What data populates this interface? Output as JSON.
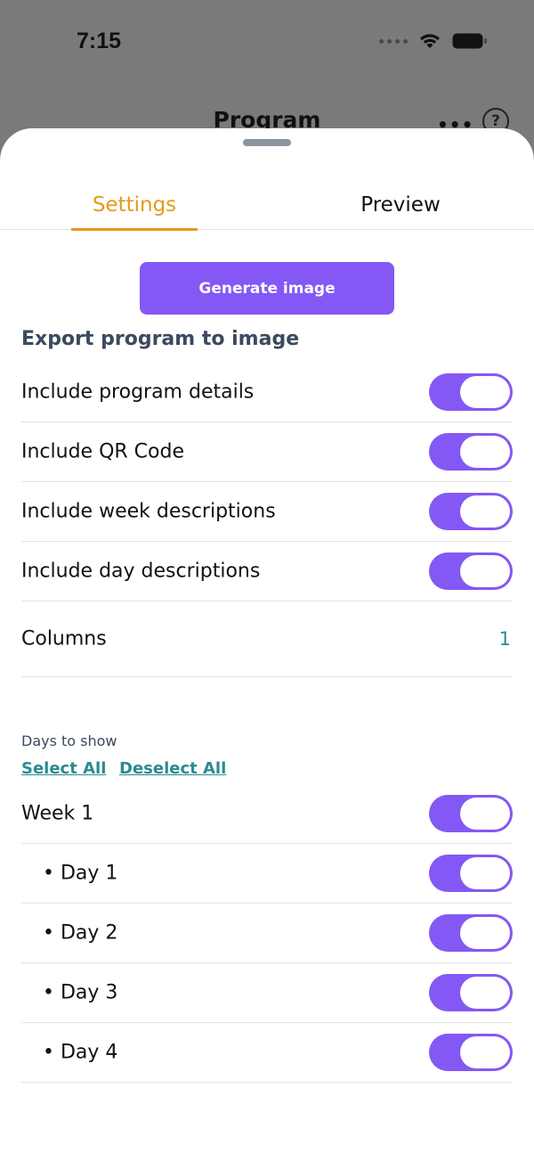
{
  "status_bar": {
    "time": "7:15",
    "icons": [
      "cellular-dots-icon",
      "wifi-icon",
      "battery-icon"
    ]
  },
  "background_nav": {
    "title": "Program",
    "more_icon": "more-horizontal-icon",
    "help_label": "?"
  },
  "tabs": [
    {
      "label": "Settings",
      "active": true
    },
    {
      "label": "Preview",
      "active": false
    }
  ],
  "generate_button": {
    "label": "Generate image"
  },
  "export_section": {
    "title": "Export program to image",
    "options": [
      {
        "label": "Include program details",
        "on": true
      },
      {
        "label": "Include QR Code",
        "on": true
      },
      {
        "label": "Include week descriptions",
        "on": true
      },
      {
        "label": "Include day descriptions",
        "on": true
      }
    ],
    "columns": {
      "label": "Columns",
      "value": "1"
    }
  },
  "days_section": {
    "caption": "Days to show",
    "select_all": "Select All",
    "deselect_all": "Deselect All",
    "items": [
      {
        "label": "Week 1",
        "on": true
      },
      {
        "label": "• Day 1",
        "on": true
      },
      {
        "label": "• Day 2",
        "on": true
      },
      {
        "label": "• Day 3",
        "on": true
      },
      {
        "label": "• Day 4",
        "on": true
      }
    ]
  },
  "colors": {
    "accent_purple": "#8458f4",
    "tab_active": "#e59a1c",
    "link_teal": "#2b8a93",
    "heading": "#3b4a5e"
  }
}
